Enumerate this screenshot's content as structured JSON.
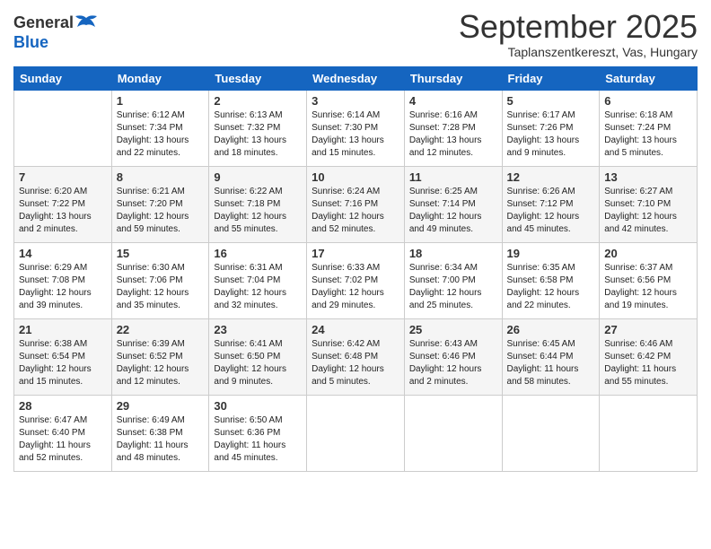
{
  "header": {
    "logo_general": "General",
    "logo_blue": "Blue",
    "month_title": "September 2025",
    "subtitle": "Taplanszentkereszt, Vas, Hungary"
  },
  "days_of_week": [
    "Sunday",
    "Monday",
    "Tuesday",
    "Wednesday",
    "Thursday",
    "Friday",
    "Saturday"
  ],
  "weeks": [
    [
      {
        "day": "",
        "info": ""
      },
      {
        "day": "1",
        "info": "Sunrise: 6:12 AM\nSunset: 7:34 PM\nDaylight: 13 hours\nand 22 minutes."
      },
      {
        "day": "2",
        "info": "Sunrise: 6:13 AM\nSunset: 7:32 PM\nDaylight: 13 hours\nand 18 minutes."
      },
      {
        "day": "3",
        "info": "Sunrise: 6:14 AM\nSunset: 7:30 PM\nDaylight: 13 hours\nand 15 minutes."
      },
      {
        "day": "4",
        "info": "Sunrise: 6:16 AM\nSunset: 7:28 PM\nDaylight: 13 hours\nand 12 minutes."
      },
      {
        "day": "5",
        "info": "Sunrise: 6:17 AM\nSunset: 7:26 PM\nDaylight: 13 hours\nand 9 minutes."
      },
      {
        "day": "6",
        "info": "Sunrise: 6:18 AM\nSunset: 7:24 PM\nDaylight: 13 hours\nand 5 minutes."
      }
    ],
    [
      {
        "day": "7",
        "info": "Sunrise: 6:20 AM\nSunset: 7:22 PM\nDaylight: 13 hours\nand 2 minutes."
      },
      {
        "day": "8",
        "info": "Sunrise: 6:21 AM\nSunset: 7:20 PM\nDaylight: 12 hours\nand 59 minutes."
      },
      {
        "day": "9",
        "info": "Sunrise: 6:22 AM\nSunset: 7:18 PM\nDaylight: 12 hours\nand 55 minutes."
      },
      {
        "day": "10",
        "info": "Sunrise: 6:24 AM\nSunset: 7:16 PM\nDaylight: 12 hours\nand 52 minutes."
      },
      {
        "day": "11",
        "info": "Sunrise: 6:25 AM\nSunset: 7:14 PM\nDaylight: 12 hours\nand 49 minutes."
      },
      {
        "day": "12",
        "info": "Sunrise: 6:26 AM\nSunset: 7:12 PM\nDaylight: 12 hours\nand 45 minutes."
      },
      {
        "day": "13",
        "info": "Sunrise: 6:27 AM\nSunset: 7:10 PM\nDaylight: 12 hours\nand 42 minutes."
      }
    ],
    [
      {
        "day": "14",
        "info": "Sunrise: 6:29 AM\nSunset: 7:08 PM\nDaylight: 12 hours\nand 39 minutes."
      },
      {
        "day": "15",
        "info": "Sunrise: 6:30 AM\nSunset: 7:06 PM\nDaylight: 12 hours\nand 35 minutes."
      },
      {
        "day": "16",
        "info": "Sunrise: 6:31 AM\nSunset: 7:04 PM\nDaylight: 12 hours\nand 32 minutes."
      },
      {
        "day": "17",
        "info": "Sunrise: 6:33 AM\nSunset: 7:02 PM\nDaylight: 12 hours\nand 29 minutes."
      },
      {
        "day": "18",
        "info": "Sunrise: 6:34 AM\nSunset: 7:00 PM\nDaylight: 12 hours\nand 25 minutes."
      },
      {
        "day": "19",
        "info": "Sunrise: 6:35 AM\nSunset: 6:58 PM\nDaylight: 12 hours\nand 22 minutes."
      },
      {
        "day": "20",
        "info": "Sunrise: 6:37 AM\nSunset: 6:56 PM\nDaylight: 12 hours\nand 19 minutes."
      }
    ],
    [
      {
        "day": "21",
        "info": "Sunrise: 6:38 AM\nSunset: 6:54 PM\nDaylight: 12 hours\nand 15 minutes."
      },
      {
        "day": "22",
        "info": "Sunrise: 6:39 AM\nSunset: 6:52 PM\nDaylight: 12 hours\nand 12 minutes."
      },
      {
        "day": "23",
        "info": "Sunrise: 6:41 AM\nSunset: 6:50 PM\nDaylight: 12 hours\nand 9 minutes."
      },
      {
        "day": "24",
        "info": "Sunrise: 6:42 AM\nSunset: 6:48 PM\nDaylight: 12 hours\nand 5 minutes."
      },
      {
        "day": "25",
        "info": "Sunrise: 6:43 AM\nSunset: 6:46 PM\nDaylight: 12 hours\nand 2 minutes."
      },
      {
        "day": "26",
        "info": "Sunrise: 6:45 AM\nSunset: 6:44 PM\nDaylight: 11 hours\nand 58 minutes."
      },
      {
        "day": "27",
        "info": "Sunrise: 6:46 AM\nSunset: 6:42 PM\nDaylight: 11 hours\nand 55 minutes."
      }
    ],
    [
      {
        "day": "28",
        "info": "Sunrise: 6:47 AM\nSunset: 6:40 PM\nDaylight: 11 hours\nand 52 minutes."
      },
      {
        "day": "29",
        "info": "Sunrise: 6:49 AM\nSunset: 6:38 PM\nDaylight: 11 hours\nand 48 minutes."
      },
      {
        "day": "30",
        "info": "Sunrise: 6:50 AM\nSunset: 6:36 PM\nDaylight: 11 hours\nand 45 minutes."
      },
      {
        "day": "",
        "info": ""
      },
      {
        "day": "",
        "info": ""
      },
      {
        "day": "",
        "info": ""
      },
      {
        "day": "",
        "info": ""
      }
    ]
  ]
}
